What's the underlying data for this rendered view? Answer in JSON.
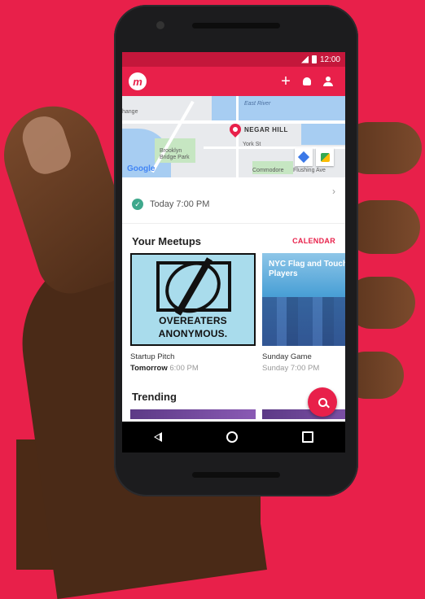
{
  "statusbar": {
    "time": "12:00"
  },
  "appbar": {
    "logo_letter": "m",
    "add_glyph": "+"
  },
  "map": {
    "pin_label": "NEGAR HILL",
    "labels": [
      "East River",
      "Brooklyn Bridge Park",
      "York St",
      "Commodore",
      "Flushing Ave",
      "hange"
    ],
    "google_label": "Google"
  },
  "event": {
    "time": "Today 7:00 PM",
    "chevron": "›",
    "check": "✓"
  },
  "your_meetups": {
    "title": "Your Meetups",
    "calendar_label": "CALENDAR",
    "cards": [
      {
        "image_text_1": "OVEREATERS",
        "image_text_2": "ANONYMOUS.",
        "name": "Startup Pitch",
        "when_bold": "Tomorrow",
        "when_rest": " 6:00 PM"
      },
      {
        "image_title": "NYC Flag and Touch Football Players",
        "name": "Sunday Game",
        "when_rest": "Sunday 7:00 PM"
      }
    ]
  },
  "trending": {
    "title": "Trending"
  },
  "colors": {
    "brand": "#e8204a",
    "status_bar": "#c4173b",
    "check": "#3fa88c"
  }
}
